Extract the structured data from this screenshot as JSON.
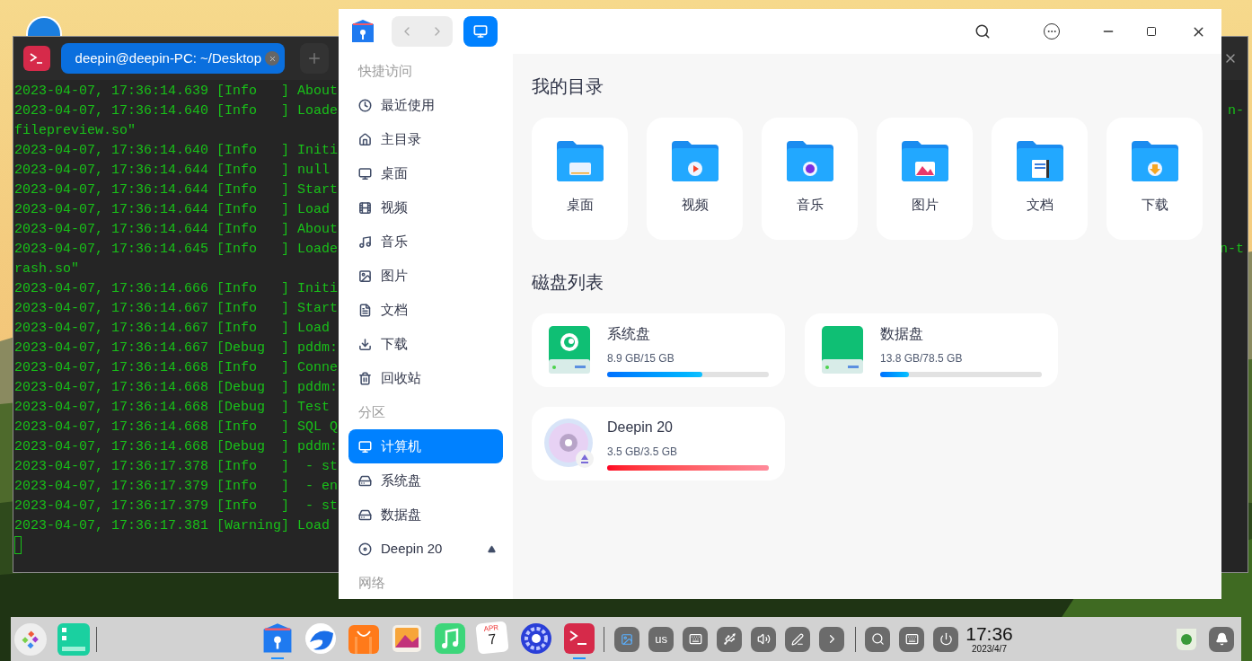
{
  "terminal": {
    "tab_title": "deepin@deepin-PC: ~/Desktop",
    "lines": [
      {
        "text": "2023-04-07, 17:36:14.639 [Info   ] About"
      },
      {
        "text": "2023-04-07, 17:36:14.640 [Info   ] Loade",
        "tail": "n-"
      },
      {
        "text": "filepreview.so\""
      },
      {
        "text": "2023-04-07, 17:36:14.640 [Info   ] Initi"
      },
      {
        "text": "2023-04-07, 17:36:14.644 [Info   ] null"
      },
      {
        "text": "2023-04-07, 17:36:14.644 [Info   ] Start"
      },
      {
        "text": "2023-04-07, 17:36:14.644 [Info   ] Load"
      },
      {
        "text": "2023-04-07, 17:36:14.644 [Info   ] About"
      },
      {
        "text": "2023-04-07, 17:36:14.645 [Info   ] Loade",
        "tail": "n-t"
      },
      {
        "text": "rash.so\""
      },
      {
        "text": "2023-04-07, 17:36:14.666 [Info   ] Initi"
      },
      {
        "text": "2023-04-07, 17:36:14.667 [Info   ] Start"
      },
      {
        "text": "2023-04-07, 17:36:14.667 [Info   ] Load"
      },
      {
        "text": "2023-04-07, 17:36:14.667 [Debug  ] pddm:"
      },
      {
        "text": "2023-04-07, 17:36:14.668 [Info   ] Conne"
      },
      {
        "text": "2023-04-07, 17:36:14.668 [Debug  ] pddm:"
      },
      {
        "text": "2023-04-07, 17:36:14.668 [Debug  ] Test"
      },
      {
        "text": "2023-04-07, 17:36:14.668 [Info   ] SQL Q"
      },
      {
        "text": "2023-04-07, 17:36:14.668 [Debug  ] pddm:"
      },
      {
        "text": "2023-04-07, 17:36:17.378 [Info   ]  - st"
      },
      {
        "text": "2023-04-07, 17:36:17.379 [Info   ]  - en"
      },
      {
        "text": "2023-04-07, 17:36:17.379 [Info   ]  - st"
      },
      {
        "text": "2023-04-07, 17:36:17.381 [Warning] Load"
      }
    ]
  },
  "file_manager": {
    "sidebar": [
      {
        "title": "快捷访问",
        "items": [
          {
            "label": "最近使用",
            "selected": false
          },
          {
            "label": "主目录",
            "selected": false
          },
          {
            "label": "桌面",
            "selected": false
          },
          {
            "label": "视频",
            "selected": false
          },
          {
            "label": "音乐",
            "selected": false
          },
          {
            "label": "图片",
            "selected": false
          },
          {
            "label": "文档",
            "selected": false
          },
          {
            "label": "下载",
            "selected": false
          },
          {
            "label": "回收站",
            "selected": false
          }
        ]
      },
      {
        "title": "分区",
        "items": [
          {
            "label": "计算机",
            "kind": "computer",
            "selected": true
          },
          {
            "label": "系统盘",
            "kind": "disk",
            "selected": false
          },
          {
            "label": "数据盘",
            "kind": "disk",
            "selected": false
          },
          {
            "label": "Deepin 20",
            "kind": "optical",
            "selected": false
          }
        ]
      },
      {
        "title": "网络"
      }
    ],
    "my_directory": {
      "title": "我的目录",
      "folders": [
        "桌面",
        "视频",
        "音乐",
        "图片",
        "文档",
        "下载"
      ]
    },
    "disk_list": {
      "title": "磁盘列表",
      "disks": [
        {
          "kind": "system",
          "name": "系统盘",
          "usage": "8.9 GB/15 GB",
          "level": 0.59
        },
        {
          "kind": "data",
          "name": "数据盘",
          "usage": "13.8 GB/78.5 GB",
          "level": 0.18
        },
        {
          "kind": "optical",
          "name": "Deepin 20",
          "usage": "3.5 GB/3.5 GB",
          "level": 1
        }
      ]
    }
  },
  "dock": {
    "apps": [
      {
        "running": true
      },
      {
        "running": false
      },
      {
        "running": false
      },
      {
        "running": false
      },
      {
        "running": false
      },
      {
        "running": false,
        "month": "APR",
        "day": "7"
      },
      {
        "running": false
      },
      {
        "running": true
      }
    ],
    "keyboard_layout": "us",
    "time": "17:36",
    "date": "2023/4/7"
  }
}
